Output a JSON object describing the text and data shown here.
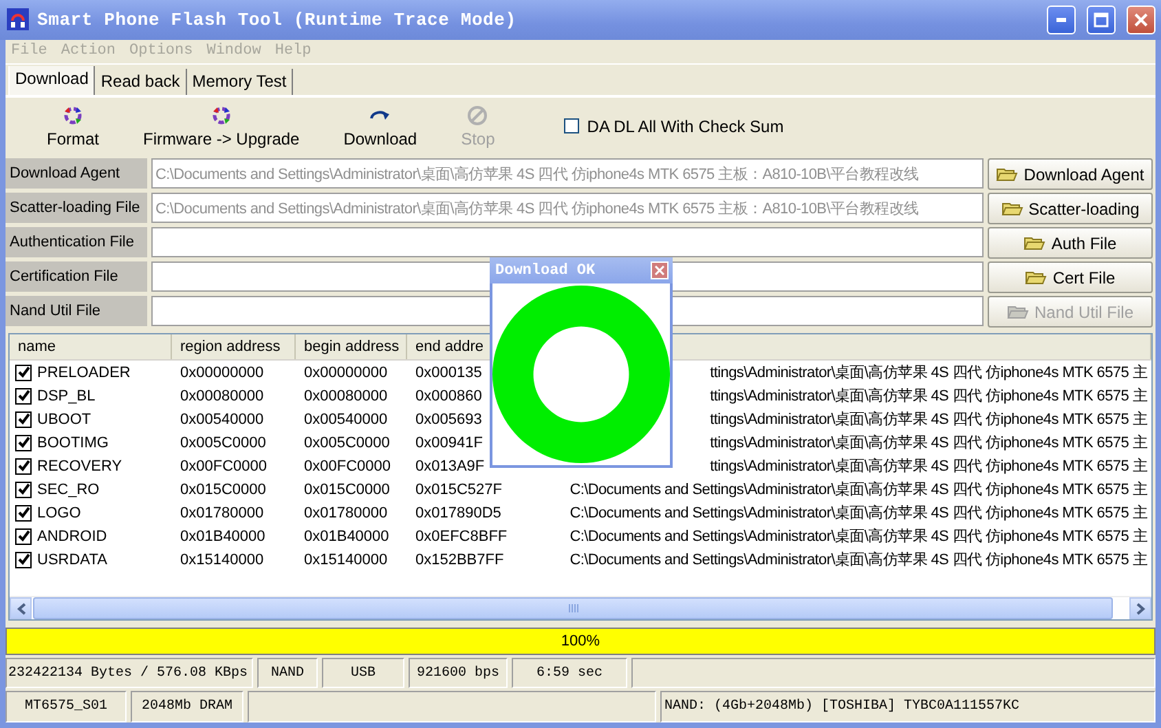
{
  "window": {
    "title": "Smart Phone Flash Tool (Runtime Trace Mode)"
  },
  "menu": [
    {
      "label": "File",
      "disabled": true
    },
    {
      "label": "Action",
      "disabled": true
    },
    {
      "label": "Options",
      "disabled": true
    },
    {
      "label": "Window",
      "disabled": true
    },
    {
      "label": "Help",
      "disabled": true
    }
  ],
  "tabs": [
    {
      "label": "Download",
      "selected": true
    },
    {
      "label": "Read back",
      "selected": false
    },
    {
      "label": "Memory Test",
      "selected": false
    }
  ],
  "toolbar": [
    {
      "kind": "format",
      "label": "Format",
      "disabled": false
    },
    {
      "kind": "upgrade",
      "label": "Firmware -> Upgrade",
      "disabled": false
    },
    {
      "kind": "download",
      "label": "Download",
      "disabled": false
    },
    {
      "kind": "stop",
      "label": "Stop",
      "disabled": true
    }
  ],
  "checksum": {
    "label": "DA DL All With Check Sum",
    "checked": false
  },
  "file_fields": [
    {
      "label": "Download Agent",
      "value": "C:\\Documents and Settings\\Administrator\\桌面\\高仿苹果 4S 四代 仿iphone4s MTK 6575 主板：A810-10B\\平台教程改线",
      "button": "Download Agent",
      "disabled": false
    },
    {
      "label": "Scatter-loading File",
      "value": "C:\\Documents and Settings\\Administrator\\桌面\\高仿苹果 4S 四代 仿iphone4s MTK 6575 主板：A810-10B\\平台教程改线",
      "button": "Scatter-loading",
      "disabled": false
    },
    {
      "label": "Authentication File",
      "button": "Auth File",
      "disabled": false
    },
    {
      "label": "Certification File",
      "button": "Cert File",
      "disabled": false
    },
    {
      "label": "Nand Util File",
      "button": "Nand Util File",
      "disabled": true
    }
  ],
  "table": {
    "columns": [
      "name",
      "region address",
      "begin address",
      "end addre"
    ],
    "rows": [
      {
        "checked": true,
        "cells": [
          "PRELOADER",
          "0x00000000",
          "0x00000000",
          "0x000135",
          "ttings\\Administrator\\桌面\\高仿苹果 4S 四代 仿iphone4s MTK 6575 主"
        ]
      },
      {
        "checked": true,
        "cells": [
          "DSP_BL",
          "0x00080000",
          "0x00080000",
          "0x000860",
          "ttings\\Administrator\\桌面\\高仿苹果 4S 四代 仿iphone4s MTK 6575 主"
        ]
      },
      {
        "checked": true,
        "cells": [
          "UBOOT",
          "0x00540000",
          "0x00540000",
          "0x005693",
          "ttings\\Administrator\\桌面\\高仿苹果 4S 四代 仿iphone4s MTK 6575 主"
        ]
      },
      {
        "checked": true,
        "cells": [
          "BOOTIMG",
          "0x005C0000",
          "0x005C0000",
          "0x00941F",
          "ttings\\Administrator\\桌面\\高仿苹果 4S 四代 仿iphone4s MTK 6575 主"
        ]
      },
      {
        "checked": true,
        "cells": [
          "RECOVERY",
          "0x00FC0000",
          "0x00FC0000",
          "0x013A9F",
          "ttings\\Administrator\\桌面\\高仿苹果 4S 四代 仿iphone4s MTK 6575 主"
        ]
      },
      {
        "checked": true,
        "cells": [
          "SEC_RO",
          "0x015C0000",
          "0x015C0000",
          "0x015C527F",
          "C:\\Documents and Settings\\Administrator\\桌面\\高仿苹果 4S 四代 仿iphone4s MTK 6575 主"
        ]
      },
      {
        "checked": true,
        "cells": [
          "LOGO",
          "0x01780000",
          "0x01780000",
          "0x017890D5",
          "C:\\Documents and Settings\\Administrator\\桌面\\高仿苹果 4S 四代 仿iphone4s MTK 6575 主"
        ]
      },
      {
        "checked": true,
        "cells": [
          "ANDROID",
          "0x01B40000",
          "0x01B40000",
          "0x0EFC8BFF",
          "C:\\Documents and Settings\\Administrator\\桌面\\高仿苹果 4S 四代 仿iphone4s MTK 6575 主"
        ]
      },
      {
        "checked": true,
        "cells": [
          "USRDATA",
          "0x15140000",
          "0x15140000",
          "0x152BB7FF",
          "C:\\Documents and Settings\\Administrator\\桌面\\高仿苹果 4S 四代 仿iphone4s MTK 6575 主"
        ]
      }
    ]
  },
  "dialog": {
    "title": "Download OK"
  },
  "progress": {
    "label": "100%",
    "level": 1
  },
  "status_bar": {
    "row_1": [
      "232422134 Bytes / 576.08 KBps",
      "NAND",
      "USB",
      "921600 bps",
      "6:59 sec"
    ],
    "row_2_left": [
      "MT6575_S01",
      "2048Mb DRAM"
    ],
    "row_2_right": [
      "NAND: (4Gb+2048Mb) [TOSHIBA] TYBC0A111557KC"
    ]
  }
}
